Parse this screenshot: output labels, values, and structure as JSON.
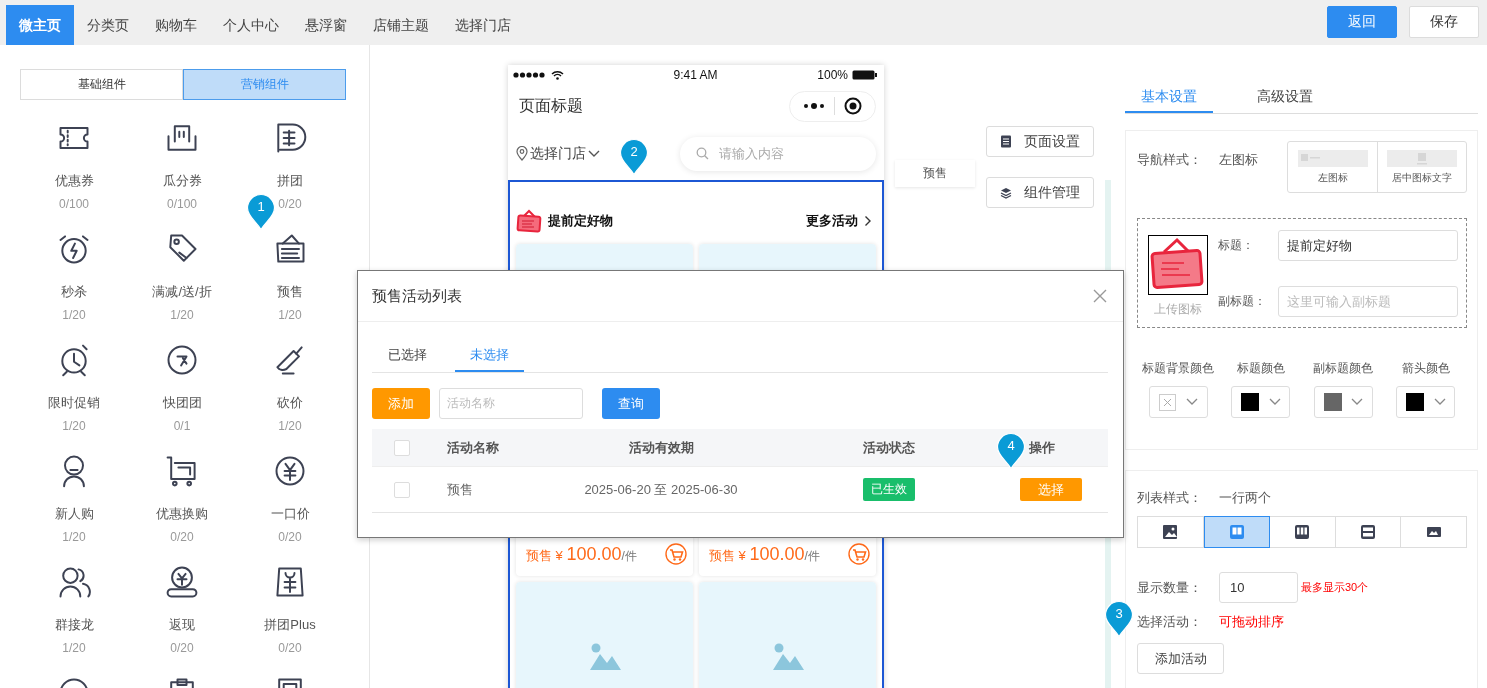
{
  "top_tabs": [
    {
      "label": "微主页",
      "selected": true
    },
    {
      "label": "分类页",
      "selected": false
    },
    {
      "label": "购物车",
      "selected": false
    },
    {
      "label": "个人中心",
      "selected": false
    },
    {
      "label": "悬浮窗",
      "selected": false
    },
    {
      "label": "店铺主题",
      "selected": false
    },
    {
      "label": "选择门店",
      "selected": false
    }
  ],
  "header_buttons": [
    {
      "label": "返回",
      "kind": "primary"
    },
    {
      "label": "保存",
      "kind": "default"
    }
  ],
  "component_panel": {
    "groups": [
      {
        "label": "基础组件",
        "selected": false
      },
      {
        "label": "营销组件",
        "selected": true
      }
    ],
    "items": [
      {
        "label": "优惠券",
        "count": "0/100"
      },
      {
        "label": "瓜分券",
        "count": "0/100"
      },
      {
        "label": "拼团",
        "count": "0/20"
      },
      {
        "label": "秒杀",
        "count": "1/20"
      },
      {
        "label": "满减/送/折",
        "count": "1/20"
      },
      {
        "label": "预售",
        "count": "1/20"
      },
      {
        "label": "限时促销",
        "count": "1/20"
      },
      {
        "label": "快团团",
        "count": "0/1"
      },
      {
        "label": "砍价",
        "count": "1/20"
      },
      {
        "label": "新人购",
        "count": "1/20"
      },
      {
        "label": "优惠换购",
        "count": "0/20"
      },
      {
        "label": "一口价",
        "count": "0/20"
      },
      {
        "label": "群接龙",
        "count": "1/20"
      },
      {
        "label": "返现",
        "count": "0/20"
      },
      {
        "label": "拼团Plus",
        "count": "0/20"
      },
      {
        "kind": "cut"
      },
      {
        "kind": "cut"
      },
      {
        "kind": "cut"
      }
    ]
  },
  "phone": {
    "status_bar": {
      "time": "9:41 AM",
      "battery": "100%"
    },
    "title": "页面标题",
    "store": "选择门店",
    "search_placeholder": "请输入内容",
    "section": {
      "title": "提前定好物",
      "more": "更多活动"
    },
    "products": [
      {
        "tag": "预售",
        "currency": "¥",
        "price": "100.00",
        "unit": "/件"
      },
      {
        "tag": "预售",
        "currency": "¥",
        "price": "100.00",
        "unit": "/件"
      },
      {
        "kind": "image"
      },
      {
        "kind": "image"
      }
    ]
  },
  "floating_label": "预售",
  "side_buttons": [
    {
      "label": "页面设置",
      "kind": "page"
    },
    {
      "label": "组件管理",
      "kind": "layers"
    }
  ],
  "settings": {
    "tabs": [
      {
        "label": "基本设置",
        "selected": true
      },
      {
        "label": "高级设置",
        "selected": false
      }
    ],
    "nav_style": {
      "label": "导航样式：",
      "value": "左图标",
      "options": [
        {
          "label": "左图标",
          "kind": "left"
        },
        {
          "label": "居中图标文字",
          "kind": "center"
        }
      ]
    },
    "icon_caption": "上传图标",
    "title_label": "标题：",
    "title_value": "提前定好物",
    "subtitle_label": "副标题：",
    "subtitle_placeholder": "这里可输入副标题",
    "colors": [
      {
        "label": "标题背景颜色"
      },
      {
        "label": "标题颜色",
        "color": "#000000"
      },
      {
        "label": "副标题颜色",
        "color": "#666666"
      },
      {
        "label": "箭头颜色",
        "color": "#000000"
      }
    ],
    "list_style": {
      "label": "列表样式：",
      "value": "一行两个",
      "options": [
        {
          "selected": false
        },
        {
          "selected": true
        },
        {
          "selected": false
        },
        {
          "selected": false
        },
        {
          "selected": false
        }
      ]
    },
    "count_label": "显示数量：",
    "count_value": "10",
    "count_hint": "最多显示30个",
    "activity_label": "选择活动：",
    "activity_hint": "可拖动排序",
    "add_button": "添加活动"
  },
  "modal": {
    "title": "预售活动列表",
    "tabs": [
      {
        "label": "已选择",
        "selected": false
      },
      {
        "label": "未选择",
        "selected": true
      }
    ],
    "add_button": "添加",
    "search_placeholder": "活动名称",
    "query_button": "查询",
    "columns": [
      "活动名称",
      "活动有效期",
      "活动状态",
      "操作"
    ],
    "rows": [
      {
        "checked": false,
        "name": "预售",
        "period": "2025-06-20 至 2025-06-30",
        "status": "已生效",
        "action": "选择"
      }
    ],
    "header_checked": false
  },
  "pins": [
    {
      "label": "1"
    },
    {
      "label": "2"
    },
    {
      "label": "3"
    },
    {
      "label": "4"
    }
  ]
}
